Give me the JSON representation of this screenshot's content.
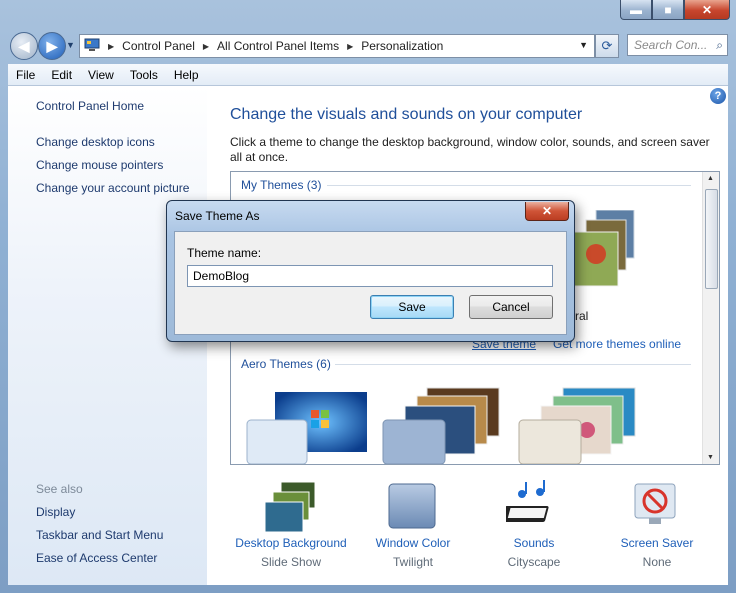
{
  "window": {
    "buttons": {
      "minimize": "▬",
      "maximize": "■",
      "close": "✕"
    }
  },
  "address": {
    "segments": [
      "Control Panel",
      "All Control Panel Items",
      "Personalization"
    ],
    "search_placeholder": "Search Con..."
  },
  "menu": [
    "File",
    "Edit",
    "View",
    "Tools",
    "Help"
  ],
  "sidebar": {
    "home": "Control Panel Home",
    "links": [
      "Change desktop icons",
      "Change mouse pointers",
      "Change your account picture"
    ],
    "see_also_title": "See also",
    "see_also": [
      "Display",
      "Taskbar and Start Menu",
      "Ease of Access Center"
    ]
  },
  "main": {
    "title": "Change the visuals and sounds on your computer",
    "description": "Click a theme to change the desktop background, window color, sounds, and screen saver all at once.",
    "my_themes_label": "My Themes (3)",
    "natural_label": "tural",
    "save_theme_link": "Save theme",
    "get_more_link": "Get more themes online",
    "aero_themes_label": "Aero Themes (6)"
  },
  "bottom": [
    {
      "label": "Desktop Background",
      "value": "Slide Show",
      "icon": "desktop-background-icon"
    },
    {
      "label": "Window Color",
      "value": "Twilight",
      "icon": "window-color-icon"
    },
    {
      "label": "Sounds",
      "value": "Cityscape",
      "icon": "sounds-icon"
    },
    {
      "label": "Screen Saver",
      "value": "None",
      "icon": "screen-saver-icon"
    }
  ],
  "dialog": {
    "title": "Save Theme As",
    "close": "✕",
    "field_label": "Theme name:",
    "field_value": "DemoBlog",
    "save_button": "Save",
    "cancel_button": "Cancel"
  },
  "colors": {
    "link": "#1f5fb8",
    "heading": "#1f4f9a",
    "frame": "#8fb0d3"
  }
}
